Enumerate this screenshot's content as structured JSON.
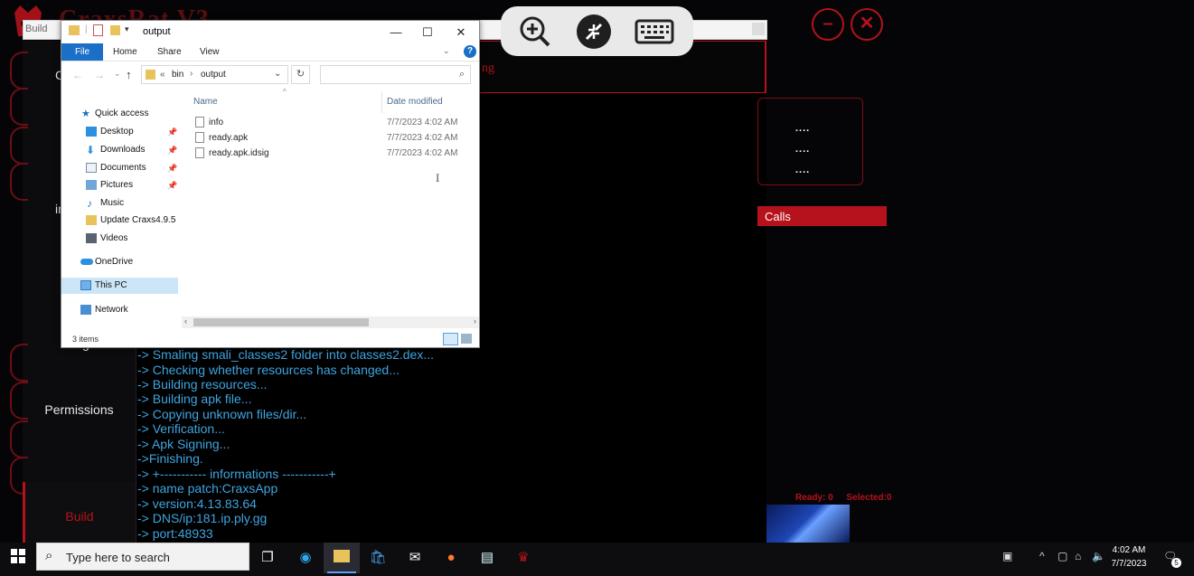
{
  "background_app": {
    "title_fragment": "CraxsRat V3",
    "window_label": "Build",
    "header_fragment": "ng",
    "nav": {
      "partial_top": "C",
      "partial_mid": "in",
      "permissions": "Permissions",
      "build": "Build",
      "partial_low": "g"
    },
    "right_panel": {
      "dots": [
        "....",
        "....",
        "...."
      ],
      "calls_fragment": "Calls",
      "ready": "Ready: 0",
      "selected": "Selected:0"
    },
    "console_lines": [
      "->  Smaling smali_classes2 folder into classes2.dex...",
      "->  Checking whether resources has changed...",
      "->  Building resources...",
      "->  Building apk file...",
      "->  Copying unknown files/dir...",
      "->  Verification...",
      "-> Apk Signing...",
      "->Finishing.",
      "-> +----------- informations -----------+",
      "-> name patch:CraxsApp",
      "-> version:4.13.83.64",
      "-> DNS/ip:181.ip.ply.gg",
      "-> port:48933"
    ],
    "colors": {
      "accent_red": "#b5121b",
      "console_text": "#3ea5e0"
    }
  },
  "remote_toolbar": {
    "zoom": "zoom-in-icon",
    "connect": "remote-desktop-icon",
    "keyboard": "keyboard-icon"
  },
  "explorer": {
    "title": "output",
    "ribbon_tabs": [
      "File",
      "Home",
      "Share",
      "View"
    ],
    "breadcrumb": {
      "sep": "«",
      "parts": [
        "bin",
        "output"
      ]
    },
    "search_placeholder": "",
    "nav_items": [
      {
        "label": "Quick access",
        "icon": "star-icon"
      },
      {
        "label": "Desktop",
        "icon": "desktop-icon",
        "pinned": true
      },
      {
        "label": "Downloads",
        "icon": "download-icon",
        "pinned": true
      },
      {
        "label": "Documents",
        "icon": "document-icon",
        "pinned": true
      },
      {
        "label": "Pictures",
        "icon": "pictures-icon",
        "pinned": true
      },
      {
        "label": "Music",
        "icon": "music-icon"
      },
      {
        "label": "Update Craxs4.9.5",
        "icon": "folder-icon"
      },
      {
        "label": "Videos",
        "icon": "video-icon"
      },
      {
        "label": "OneDrive",
        "icon": "cloud-icon"
      },
      {
        "label": "This PC",
        "icon": "pc-icon",
        "selected": true
      },
      {
        "label": "Network",
        "icon": "network-icon"
      }
    ],
    "columns": {
      "name": "Name",
      "date": "Date modified"
    },
    "files": [
      {
        "name": "info",
        "date": "7/7/2023 4:02 AM"
      },
      {
        "name": "ready.apk",
        "date": "7/7/2023 4:02 AM"
      },
      {
        "name": "ready.apk.idsig",
        "date": "7/7/2023 4:02 AM"
      }
    ],
    "status": "3 items"
  },
  "taskbar": {
    "search_placeholder": "Type here to search",
    "clock_time": "4:02 AM",
    "clock_date": "7/7/2023",
    "notification_count": "5"
  }
}
